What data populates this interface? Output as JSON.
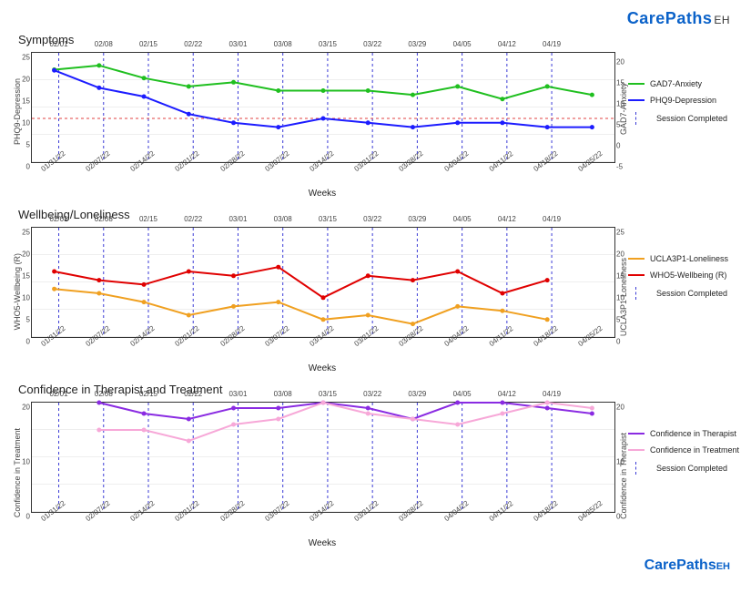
{
  "brand": {
    "name": "CarePaths",
    "suffix": "EH"
  },
  "xlabel": "Weeks",
  "session_legend": "Session Completed",
  "x_categories": [
    "01/31/22",
    "02/07/22",
    "02/14/22",
    "02/21/22",
    "02/28/22",
    "03/07/22",
    "03/14/22",
    "03/21/22",
    "03/28/22",
    "04/04/22",
    "04/11/22",
    "04/18/22",
    "04/25/22"
  ],
  "top_ticks": [
    "02/01",
    "02/08",
    "02/15",
    "02/22",
    "03/01",
    "03/08",
    "03/15",
    "03/22",
    "03/29",
    "04/05",
    "04/12",
    "04/19"
  ],
  "panels": [
    {
      "key": "symptoms",
      "title": "Symptoms",
      "y_left_label": "PHQ9-Depression",
      "y_right_label": "GAD7-Anxiety",
      "y_left": {
        "min": 0,
        "max": 25,
        "ticks": [
          0,
          5,
          10,
          15,
          20,
          25
        ]
      },
      "y_right": {
        "min": -5,
        "max": 21,
        "ticks": [
          -5,
          0,
          5,
          10,
          15,
          20
        ]
      },
      "ref_line_left": 10,
      "series": [
        {
          "name": "GAD7-Anxiety",
          "axis": "right",
          "color": "#1fbf1f",
          "values": [
            17,
            18,
            15,
            13,
            14,
            12,
            12,
            12,
            11,
            13,
            10,
            13,
            11
          ]
        },
        {
          "name": "PHQ9-Depression",
          "axis": "left",
          "color": "#1c1cff",
          "values": [
            21,
            17,
            15,
            11,
            9,
            8,
            10,
            9,
            8,
            9,
            9,
            8,
            8
          ]
        }
      ]
    },
    {
      "key": "wellbeing",
      "title": "Wellbeing/Loneliness",
      "y_left_label": "WHO5-Wellbeing (R)",
      "y_right_label": "UCLA3P1-Loneliness",
      "y_left": {
        "min": 0,
        "max": 25,
        "ticks": [
          0,
          5,
          10,
          15,
          20,
          25
        ]
      },
      "y_right": {
        "min": 0,
        "max": 25,
        "ticks": [
          0,
          5,
          10,
          15,
          20,
          25
        ]
      },
      "series": [
        {
          "name": "UCLA3P1-Loneliness",
          "axis": "right",
          "color": "#f0a020",
          "values": [
            11,
            10,
            8,
            5,
            7,
            8,
            4,
            5,
            3,
            7,
            6,
            4,
            null
          ]
        },
        {
          "name": "WHO5-Wellbeing (R)",
          "axis": "left",
          "color": "#e00000",
          "values": [
            15,
            13,
            12,
            15,
            14,
            16,
            9,
            14,
            13,
            15,
            10,
            13,
            null
          ]
        }
      ]
    },
    {
      "key": "confidence",
      "title": "Confidence in Therapist and Treatment",
      "y_left_label": "Confidence in Treatment",
      "y_right_label": "Confidence in Therapist",
      "y_left": {
        "min": 0,
        "max": 20,
        "ticks": [
          0,
          10,
          20
        ]
      },
      "y_right": {
        "min": 0,
        "max": 20,
        "ticks": [
          0,
          10,
          20
        ]
      },
      "series": [
        {
          "name": "Confidence in Therapist",
          "axis": "right",
          "color": "#8a2be2",
          "values": [
            null,
            20,
            18,
            17,
            19,
            19,
            20,
            19,
            17,
            20,
            20,
            19,
            18
          ]
        },
        {
          "name": "Confidence in Treatment",
          "axis": "left",
          "color": "#f7a8d8",
          "values": [
            null,
            15,
            15,
            13,
            16,
            17,
            20,
            18,
            17,
            16,
            18,
            20,
            19
          ]
        }
      ]
    }
  ],
  "chart_data": [
    {
      "type": "line",
      "title": "Symptoms",
      "x": [
        "01/31/22",
        "02/07/22",
        "02/14/22",
        "02/21/22",
        "02/28/22",
        "03/07/22",
        "03/14/22",
        "03/21/22",
        "03/28/22",
        "04/04/22",
        "04/11/22",
        "04/18/22",
        "04/25/22"
      ],
      "series": [
        {
          "name": "GAD7-Anxiety",
          "axis": "right",
          "values": [
            17,
            18,
            15,
            13,
            14,
            12,
            12,
            12,
            11,
            13,
            10,
            13,
            11
          ]
        },
        {
          "name": "PHQ9-Depression",
          "axis": "left",
          "values": [
            21,
            17,
            15,
            11,
            9,
            8,
            10,
            9,
            8,
            9,
            9,
            8,
            8
          ]
        }
      ],
      "y_left": {
        "label": "PHQ9-Depression",
        "range": [
          0,
          25
        ]
      },
      "y_right": {
        "label": "GAD7-Anxiety",
        "range": [
          -5,
          21
        ]
      },
      "reference_line": {
        "axis": "left",
        "value": 10
      },
      "session_markers": [
        "02/01",
        "02/08",
        "02/15",
        "02/22",
        "03/01",
        "03/08",
        "03/15",
        "03/22",
        "03/29",
        "04/05",
        "04/12",
        "04/19"
      ],
      "xlabel": "Weeks"
    },
    {
      "type": "line",
      "title": "Wellbeing/Loneliness",
      "x": [
        "01/31/22",
        "02/07/22",
        "02/14/22",
        "02/21/22",
        "02/28/22",
        "03/07/22",
        "03/14/22",
        "03/21/22",
        "03/28/22",
        "04/04/22",
        "04/11/22",
        "04/18/22",
        "04/25/22"
      ],
      "series": [
        {
          "name": "UCLA3P1-Loneliness",
          "axis": "right",
          "values": [
            11,
            10,
            8,
            5,
            7,
            8,
            4,
            5,
            3,
            7,
            6,
            4,
            null
          ]
        },
        {
          "name": "WHO5-Wellbeing (R)",
          "axis": "left",
          "values": [
            15,
            13,
            12,
            15,
            14,
            16,
            9,
            14,
            13,
            15,
            10,
            13,
            null
          ]
        }
      ],
      "y_left": {
        "label": "WHO5-Wellbeing (R)",
        "range": [
          0,
          25
        ]
      },
      "y_right": {
        "label": "UCLA3P1-Loneliness",
        "range": [
          0,
          25
        ]
      },
      "session_markers": [
        "02/01",
        "02/08",
        "02/15",
        "02/22",
        "03/01",
        "03/08",
        "03/15",
        "03/22",
        "03/29",
        "04/05",
        "04/12",
        "04/19"
      ],
      "xlabel": "Weeks"
    },
    {
      "type": "line",
      "title": "Confidence in Therapist and Treatment",
      "x": [
        "01/31/22",
        "02/07/22",
        "02/14/22",
        "02/21/22",
        "02/28/22",
        "03/07/22",
        "03/14/22",
        "03/21/22",
        "03/28/22",
        "04/04/22",
        "04/11/22",
        "04/18/22",
        "04/25/22"
      ],
      "series": [
        {
          "name": "Confidence in Therapist",
          "axis": "right",
          "values": [
            null,
            20,
            18,
            17,
            19,
            19,
            20,
            19,
            17,
            20,
            20,
            19,
            18
          ]
        },
        {
          "name": "Confidence in Treatment",
          "axis": "left",
          "values": [
            null,
            15,
            15,
            13,
            16,
            17,
            20,
            18,
            17,
            16,
            18,
            20,
            19
          ]
        }
      ],
      "y_left": {
        "label": "Confidence in Treatment",
        "range": [
          0,
          20
        ]
      },
      "y_right": {
        "label": "Confidence in Therapist",
        "range": [
          0,
          20
        ]
      },
      "session_markers": [
        "02/01",
        "02/08",
        "02/15",
        "02/22",
        "03/01",
        "03/08",
        "03/15",
        "03/22",
        "03/29",
        "04/05",
        "04/12",
        "04/19"
      ],
      "xlabel": "Weeks"
    }
  ]
}
